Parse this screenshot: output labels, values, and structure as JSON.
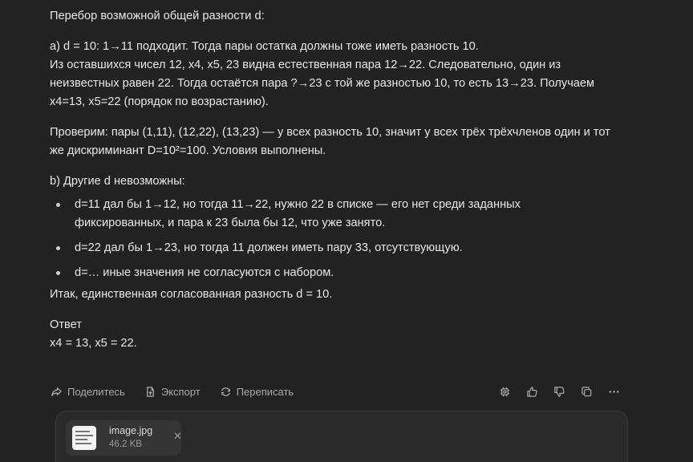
{
  "message": {
    "intro": "Перебор возможной общей разности d:",
    "case_a": {
      "line1": "a) d = 10: 1→11 подходит. Тогда пары остатка должны тоже иметь разность 10.",
      "line2": "Из оставшихся чисел 12, x4, x5, 23 видна естественная пара 12→22. Следовательно, один из",
      "line3": "неизвестных равен 22. Тогда остаётся пара ?→23 с той же разностью 10, то есть 13→23. Получаем",
      "line4": "x4=13, x5=22 (порядок по возрастанию)."
    },
    "check": {
      "line1": "Проверим: пары (1,11), (12,22), (13,23) — у всех разность 10, значит у всех трёх трёхчленов один и тот",
      "line2": "же дискриминант D=10²=100. Условия выполнены."
    },
    "case_b": {
      "heading": "b) Другие d невозможны:",
      "bullets": [
        {
          "line1": "d=11 дал бы 1→12, но тогда 11→22, нужно 22 в списке — его нет среди заданных",
          "line2": "фиксированных, и пара к 23 была бы 12, что уже занято."
        },
        {
          "line1": "d=22 дал бы 1→23, но тогда 11 должен иметь пару 33, отсутствующую."
        },
        {
          "line1": "d=… иные значения не согласуются с набором."
        }
      ]
    },
    "conclusion": "Итак, единственная согласованная разность d = 10.",
    "answer_label": "Ответ",
    "answer_value": "x4 = 13, x5 = 22."
  },
  "actions": {
    "share": "Поделитесь",
    "export": "Экспорт",
    "rewrite": "Переписать",
    "icons": [
      "chip-icon",
      "thumbs-up-icon",
      "thumbs-down-icon",
      "copy-icon",
      "more-icon"
    ]
  },
  "composer": {
    "file_name": "image.jpg",
    "file_size": "46.2 KB",
    "close_glyph": "✕"
  },
  "colors": {
    "background": "#222222",
    "text": "#e8e8e8",
    "muted": "#a9a9a9",
    "composer_bg": "#2a2a2a",
    "chip_bg": "#353535"
  }
}
